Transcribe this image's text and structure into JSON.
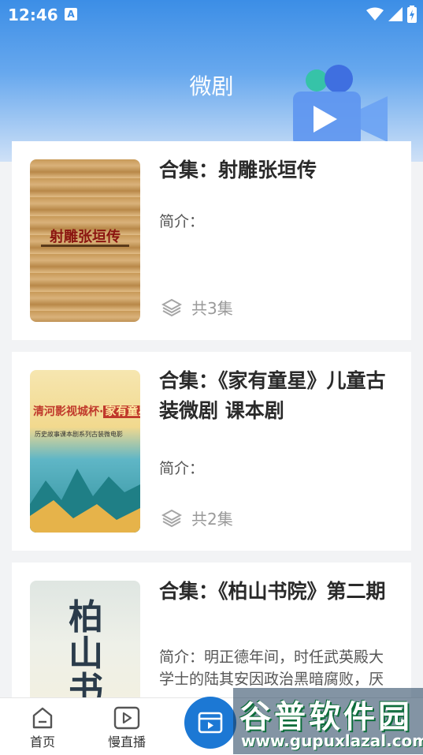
{
  "status": {
    "time": "12:46",
    "notif": "A"
  },
  "header": {
    "title": "微剧"
  },
  "items": [
    {
      "title": "合集：射雕张垣传",
      "intro": "简介：",
      "episodes": "共3集",
      "cover_text": "射雕张垣传"
    },
    {
      "title": "合集：《家有童星》儿童古装微剧 课本剧",
      "intro": "简介：",
      "episodes": "共2集",
      "cover_text_1": "清河影视城杯·",
      "cover_text_2": "家有童星",
      "cover_text_3": "历史故事课本剧系列古装微电影"
    },
    {
      "title": "合集：《柏山书院》第二期",
      "intro": "简介：明正德年间，时任武英殿大学士的陆其安因政治黑暗腐败，厌",
      "cover_text": "柏山书院"
    }
  ],
  "tabbar": {
    "tabs": [
      {
        "label": "首页"
      },
      {
        "label": "慢直播"
      }
    ]
  },
  "watermark": {
    "main": "谷普软件园",
    "url": "www.gupuxlazal.com"
  }
}
